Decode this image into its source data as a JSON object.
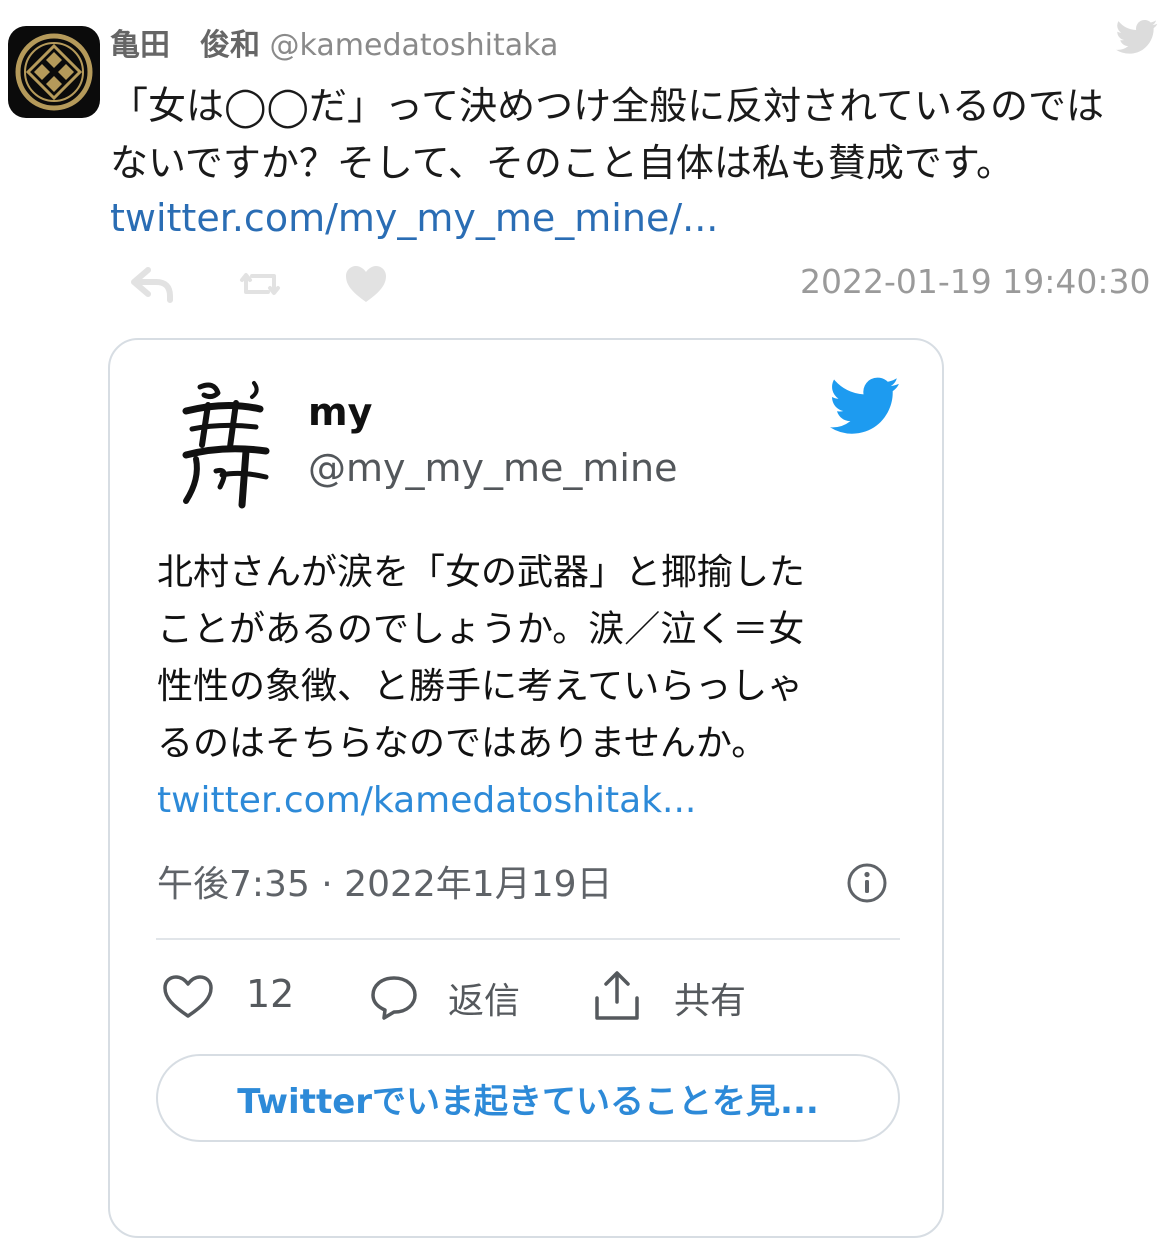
{
  "tweet": {
    "author_name": "亀田　俊和",
    "author_handle": "@kamedatoshitaka",
    "text_lines": [
      "「女は◯◯だ」って決めつけ全般に反対されているのでは",
      "ないですか？そして、そのこと自体は私も賛成です。"
    ],
    "link": "twitter.com/my_my_me_mine/...",
    "timestamp": "2022-01-19 19:40:30",
    "icons": {
      "avatar": "family-crest-icon",
      "platform": "twitter-bird-icon",
      "reply": "reply-arrow-icon",
      "retweet": "retweet-icon",
      "like": "heart-icon"
    }
  },
  "embedded": {
    "author_name": "my",
    "author_handle": "@my_my_me_mine",
    "text_lines": [
      "北村さんが涙を「女の武器」と揶揄した",
      "ことがあるのでしょうか。涙／泣く＝女",
      "性性の象徴、と勝手に考えていらっしゃ",
      "るのはそちらなのではありませんか。"
    ],
    "link": "twitter.com/kamedatoshitak...",
    "time": "午後7:35 · 2022年1月19日",
    "like_count": "12",
    "reply_label": "返信",
    "share_label": "共有",
    "cta_label": "Twitterでいま起きていることを見..."
  },
  "colors": {
    "link": "#2a6db4",
    "twitter_blue": "#1d9bf0",
    "muted": "#9a9a9a"
  }
}
